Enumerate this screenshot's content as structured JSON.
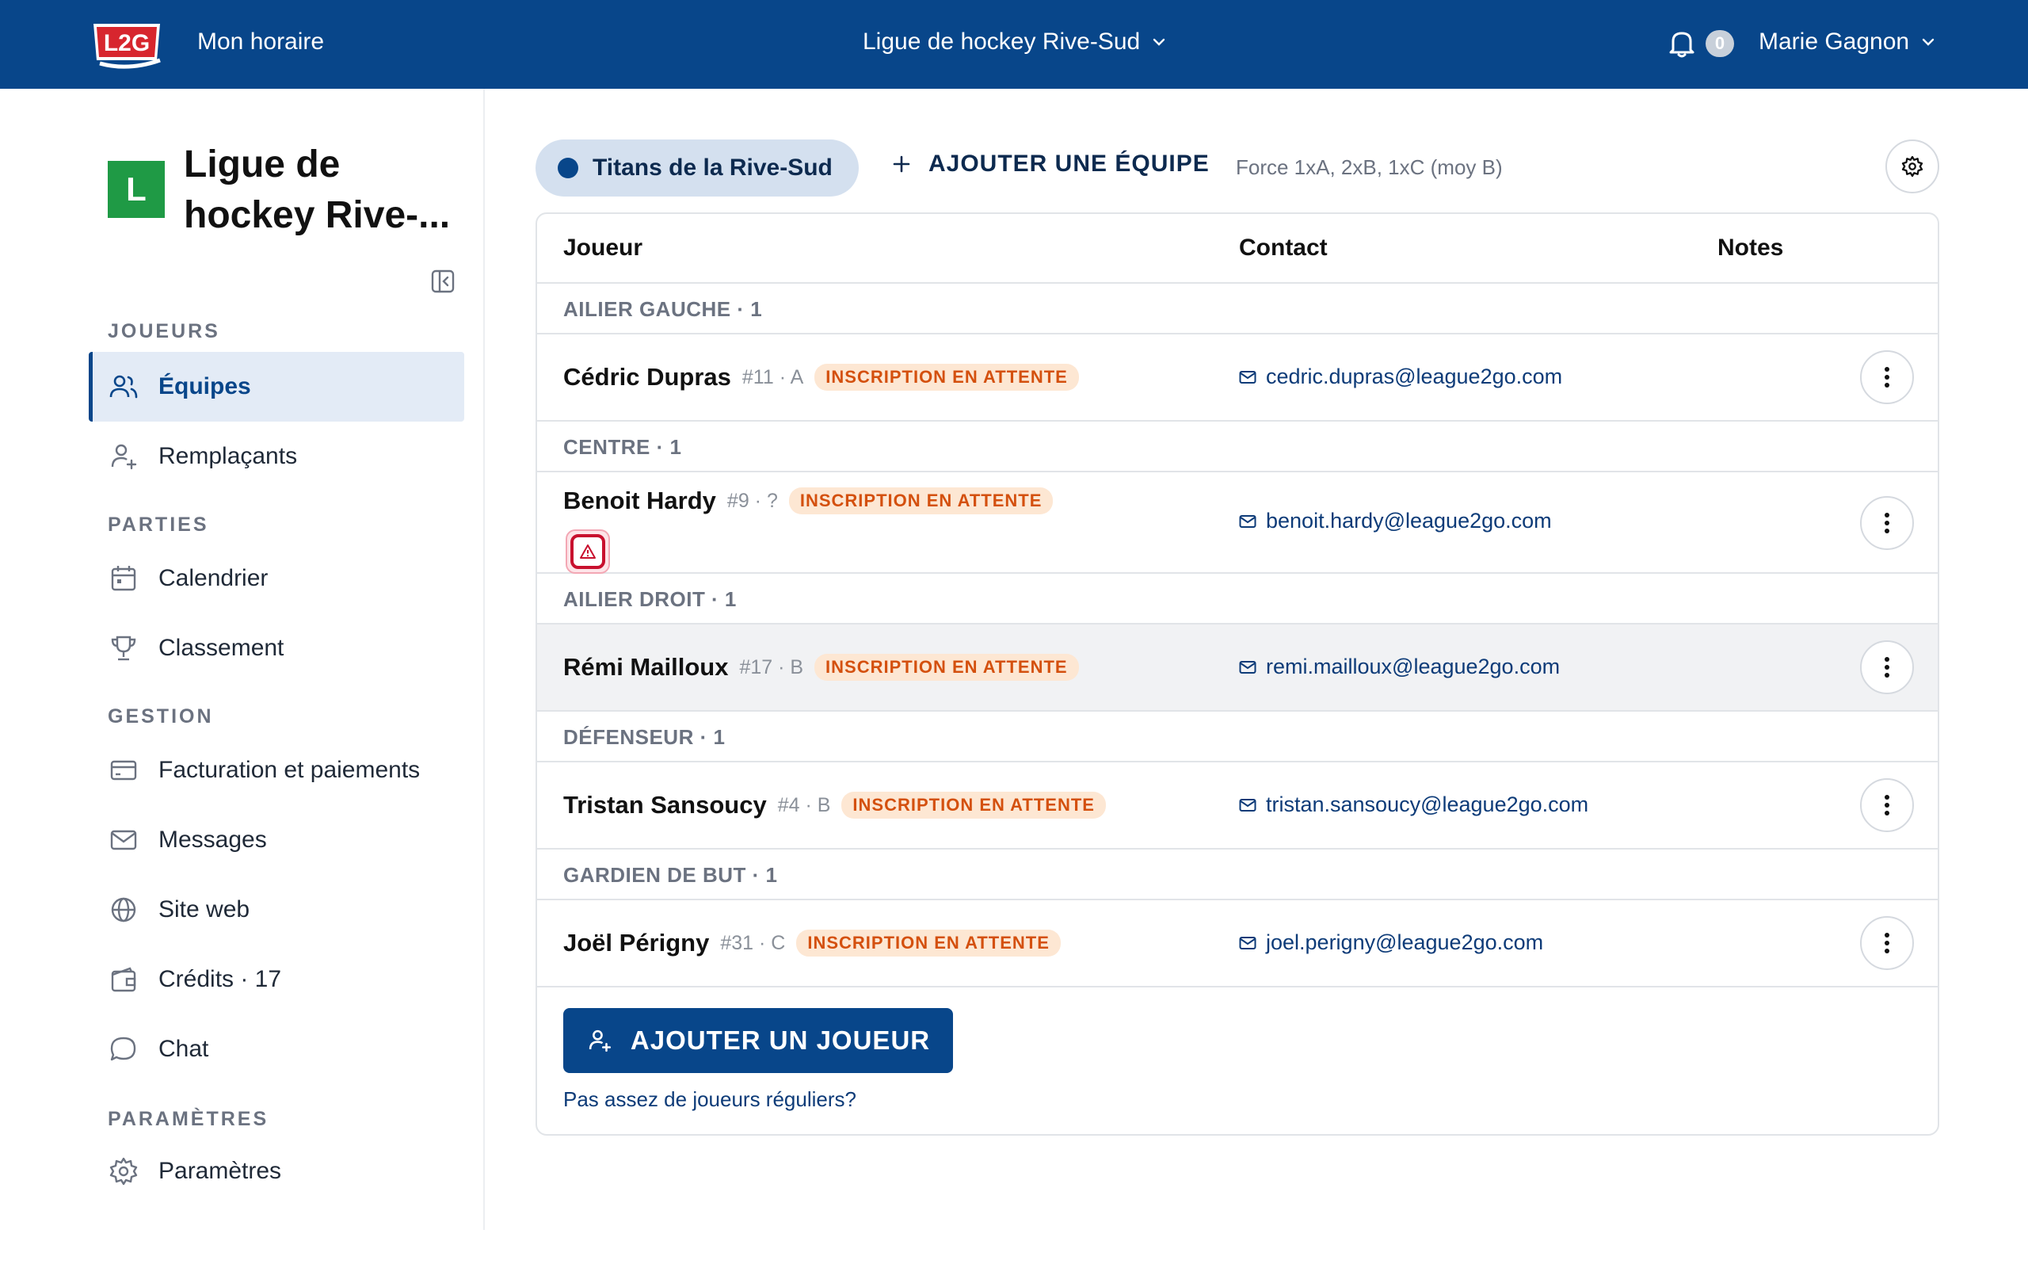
{
  "topbar": {
    "logo_text": "L2G",
    "nav_link": "Mon horaire",
    "league_switch": "Ligue de hockey Rive-Sud",
    "notif_count": "0",
    "user_name": "Marie Gagnon"
  },
  "sidebar": {
    "league_initial": "L",
    "league_name": "Ligue de hockey Rive-...",
    "sections": {
      "joueurs": "JOUEURS",
      "parties": "PARTIES",
      "gestion": "GESTION",
      "parametres": "PARAMÈTRES"
    },
    "items": {
      "equipes": "Équipes",
      "remplacants": "Remplaçants",
      "calendrier": "Calendrier",
      "classement": "Classement",
      "facturation": "Facturation et paiements",
      "messages": "Messages",
      "site_web": "Site web",
      "credits": "Crédits · 17",
      "chat": "Chat",
      "parametres": "Paramètres"
    }
  },
  "main": {
    "team_tab": "Titans de la Rive-Sud",
    "add_team": "AJOUTER UNE ÉQUIPE",
    "force": "Force 1xA, 2xB, 1xC (moy B)",
    "columns": {
      "player": "Joueur",
      "contact": "Contact",
      "notes": "Notes"
    },
    "groups": [
      {
        "label": "AILIER GAUCHE · 1",
        "player": {
          "name": "Cédric Dupras",
          "meta": "#11 · A",
          "status": "INSCRIPTION EN ATTENTE",
          "email": "cedric.dupras@league2go.com"
        }
      },
      {
        "label": "CENTRE · 1",
        "player": {
          "name": "Benoit Hardy",
          "meta": "#9 · ?",
          "status": "INSCRIPTION EN ATTENTE",
          "email": "benoit.hardy@league2go.com"
        }
      },
      {
        "label": "AILIER DROIT · 1",
        "player": {
          "name": "Rémi Mailloux",
          "meta": "#17 · B",
          "status": "INSCRIPTION EN ATTENTE",
          "email": "remi.mailloux@league2go.com"
        }
      },
      {
        "label": "DÉFENSEUR · 1",
        "player": {
          "name": "Tristan Sansoucy",
          "meta": "#4 · B",
          "status": "INSCRIPTION EN ATTENTE",
          "email": "tristan.sansoucy@league2go.com"
        }
      },
      {
        "label": "GARDIEN DE BUT · 1",
        "player": {
          "name": "Joël Périgny",
          "meta": "#31 · C",
          "status": "INSCRIPTION EN ATTENTE",
          "email": "joel.perigny@league2go.com"
        }
      }
    ],
    "add_player": "AJOUTER UN JOUEUR",
    "not_enough": "Pas assez de joueurs réguliers?"
  },
  "colors": {
    "brand": "#08468a",
    "league_icon": "#1f9a45",
    "badge_bg": "#fde7d3",
    "badge_text": "#d4500e",
    "warning": "#c8102e"
  },
  "icons": {
    "bell": "bell-icon",
    "chevron": "chevron-down-icon",
    "collapse": "sidebar-collapse-icon",
    "gear": "gear-icon",
    "mail": "mail-icon",
    "kebab": "kebab-icon",
    "warning": "warning-icon",
    "plus": "plus-icon",
    "user_plus": "user-plus-icon"
  }
}
